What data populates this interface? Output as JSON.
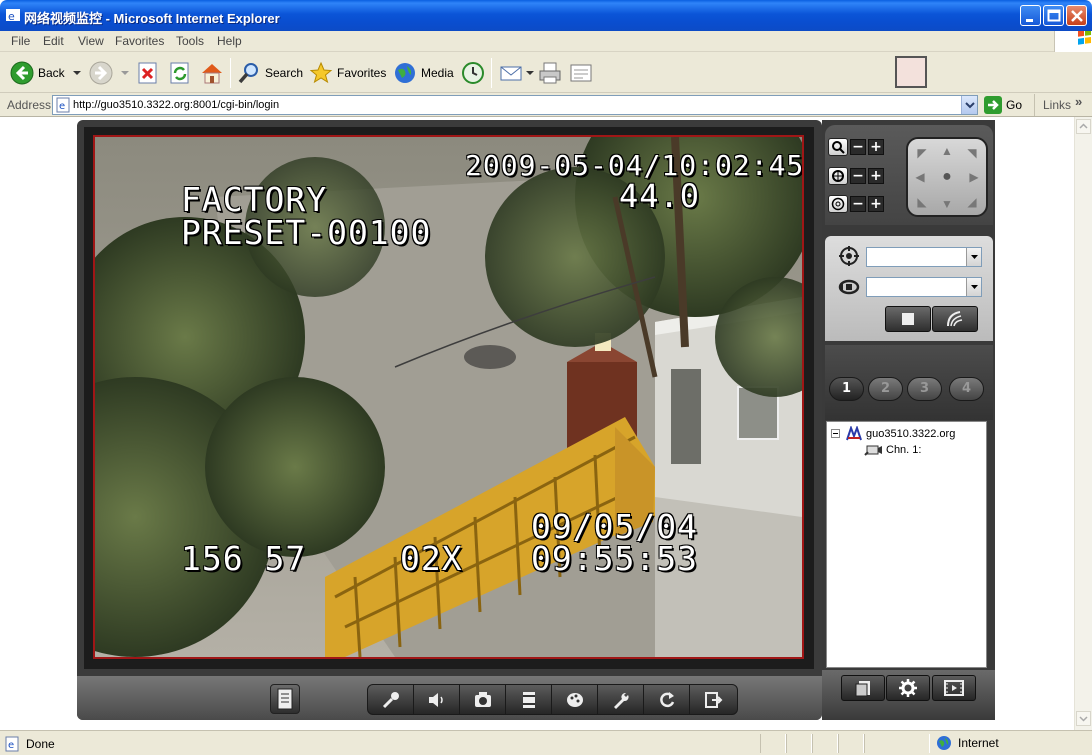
{
  "window": {
    "title": "网络视频监控 - Microsoft Internet Explorer"
  },
  "menu": [
    "File",
    "Edit",
    "View",
    "Favorites",
    "Tools",
    "Help"
  ],
  "toolbar": {
    "back_label": "Back",
    "search_label": "Search",
    "favorites_label": "Favorites",
    "media_label": "Media"
  },
  "address": {
    "label": "Address",
    "url": "http://guo3510.3322.org:8001/cgi-bin/login",
    "go_label": "Go",
    "links_label": "Links"
  },
  "video": {
    "osd_datetime": "2009-05-04/10:02:45",
    "osd_value": "44.0",
    "osd_name": "FACTORY",
    "osd_preset": "PRESET-00100",
    "osd_coords": "156 57",
    "osd_zoom": "02X",
    "osd_date": "09/05/04",
    "osd_time": "09:55:53"
  },
  "channels": [
    "1",
    "2",
    "3",
    "4"
  ],
  "active_channel": "1",
  "tree": {
    "root": "guo3510.3322.org",
    "child": "Chn. 1:"
  },
  "status": {
    "text": "Done",
    "zone": "Internet"
  },
  "colors": {
    "titlebar": "#0b55d8",
    "chrome": "#ece9d8",
    "panel_dark": "#3a3a3a",
    "video_border": "#a01616"
  }
}
